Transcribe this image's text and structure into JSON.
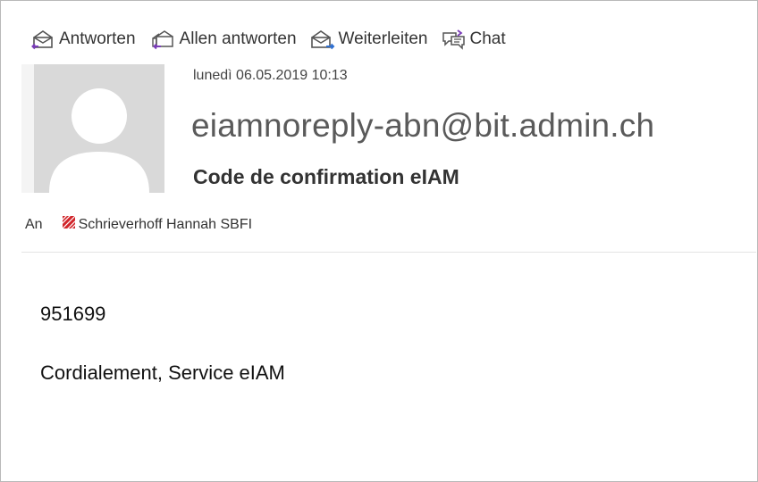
{
  "toolbar": {
    "reply_label": "Antworten",
    "reply_all_label": "Allen antworten",
    "forward_label": "Weiterleiten",
    "chat_label": "Chat"
  },
  "message": {
    "date": "lunedì 06.05.2019 10:13",
    "sender": "eiamnoreply-abn@bit.admin.ch",
    "subject": "Code de confirmation eIAM",
    "to_label": "An",
    "recipient": "Schrieverhoff Hannah SBFI",
    "body_code": "951699",
    "body_signature": "Cordialement, Service eIAM"
  },
  "icons": {
    "reply": "reply-icon",
    "reply_all": "reply-all-icon",
    "forward": "forward-icon",
    "chat": "chat-icon",
    "avatar": "avatar-placeholder",
    "recipient_status": "recipient-status-icon"
  },
  "colors": {
    "reply_arrow": "#7a3db8",
    "forward_arrow": "#2f6fd0",
    "recipient_status": "#d1262b",
    "avatar_bg": "#d9d9d9"
  }
}
